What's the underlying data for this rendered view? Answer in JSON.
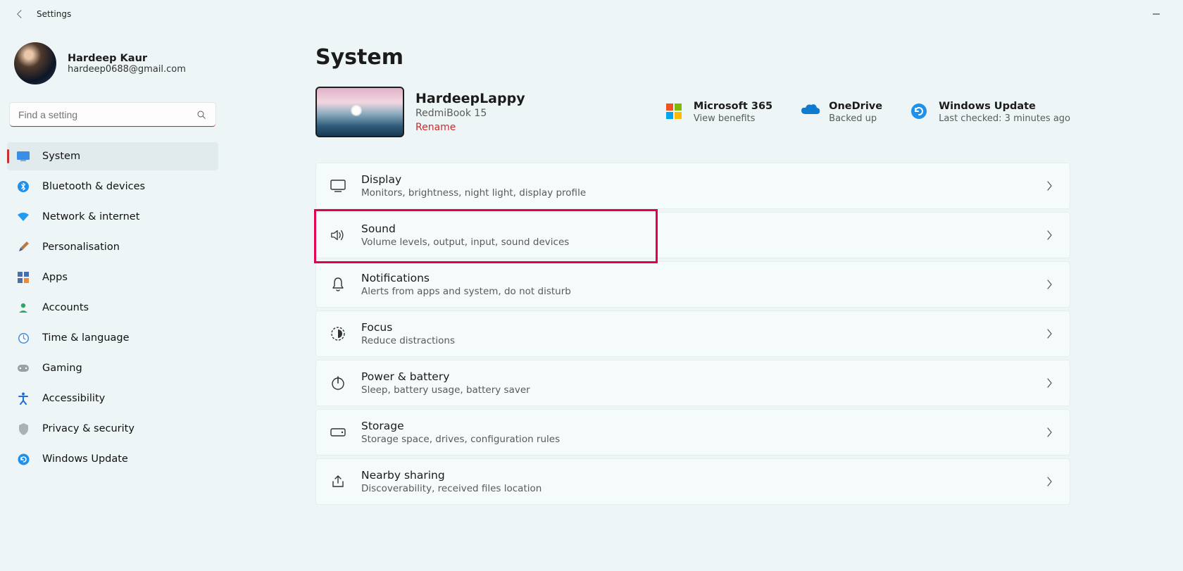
{
  "app": {
    "title": "Settings"
  },
  "user": {
    "name": "Hardeep Kaur",
    "email": "hardeep0688@gmail.com"
  },
  "search": {
    "placeholder": "Find a setting"
  },
  "sidebar": {
    "items": [
      {
        "label": "System"
      },
      {
        "label": "Bluetooth & devices"
      },
      {
        "label": "Network & internet"
      },
      {
        "label": "Personalisation"
      },
      {
        "label": "Apps"
      },
      {
        "label": "Accounts"
      },
      {
        "label": "Time & language"
      },
      {
        "label": "Gaming"
      },
      {
        "label": "Accessibility"
      },
      {
        "label": "Privacy & security"
      },
      {
        "label": "Windows Update"
      }
    ]
  },
  "page": {
    "title": "System",
    "device": {
      "name": "HardeepLappy",
      "model": "RedmiBook 15",
      "rename": "Rename"
    },
    "links": [
      {
        "title": "Microsoft 365",
        "sub": "View benefits"
      },
      {
        "title": "OneDrive",
        "sub": "Backed up"
      },
      {
        "title": "Windows Update",
        "sub": "Last checked: 3 minutes ago"
      }
    ],
    "cards": [
      {
        "title": "Display",
        "sub": "Monitors, brightness, night light, display profile"
      },
      {
        "title": "Sound",
        "sub": "Volume levels, output, input, sound devices"
      },
      {
        "title": "Notifications",
        "sub": "Alerts from apps and system, do not disturb"
      },
      {
        "title": "Focus",
        "sub": "Reduce distractions"
      },
      {
        "title": "Power & battery",
        "sub": "Sleep, battery usage, battery saver"
      },
      {
        "title": "Storage",
        "sub": "Storage space, drives, configuration rules"
      },
      {
        "title": "Nearby sharing",
        "sub": "Discoverability, received files location"
      }
    ]
  }
}
